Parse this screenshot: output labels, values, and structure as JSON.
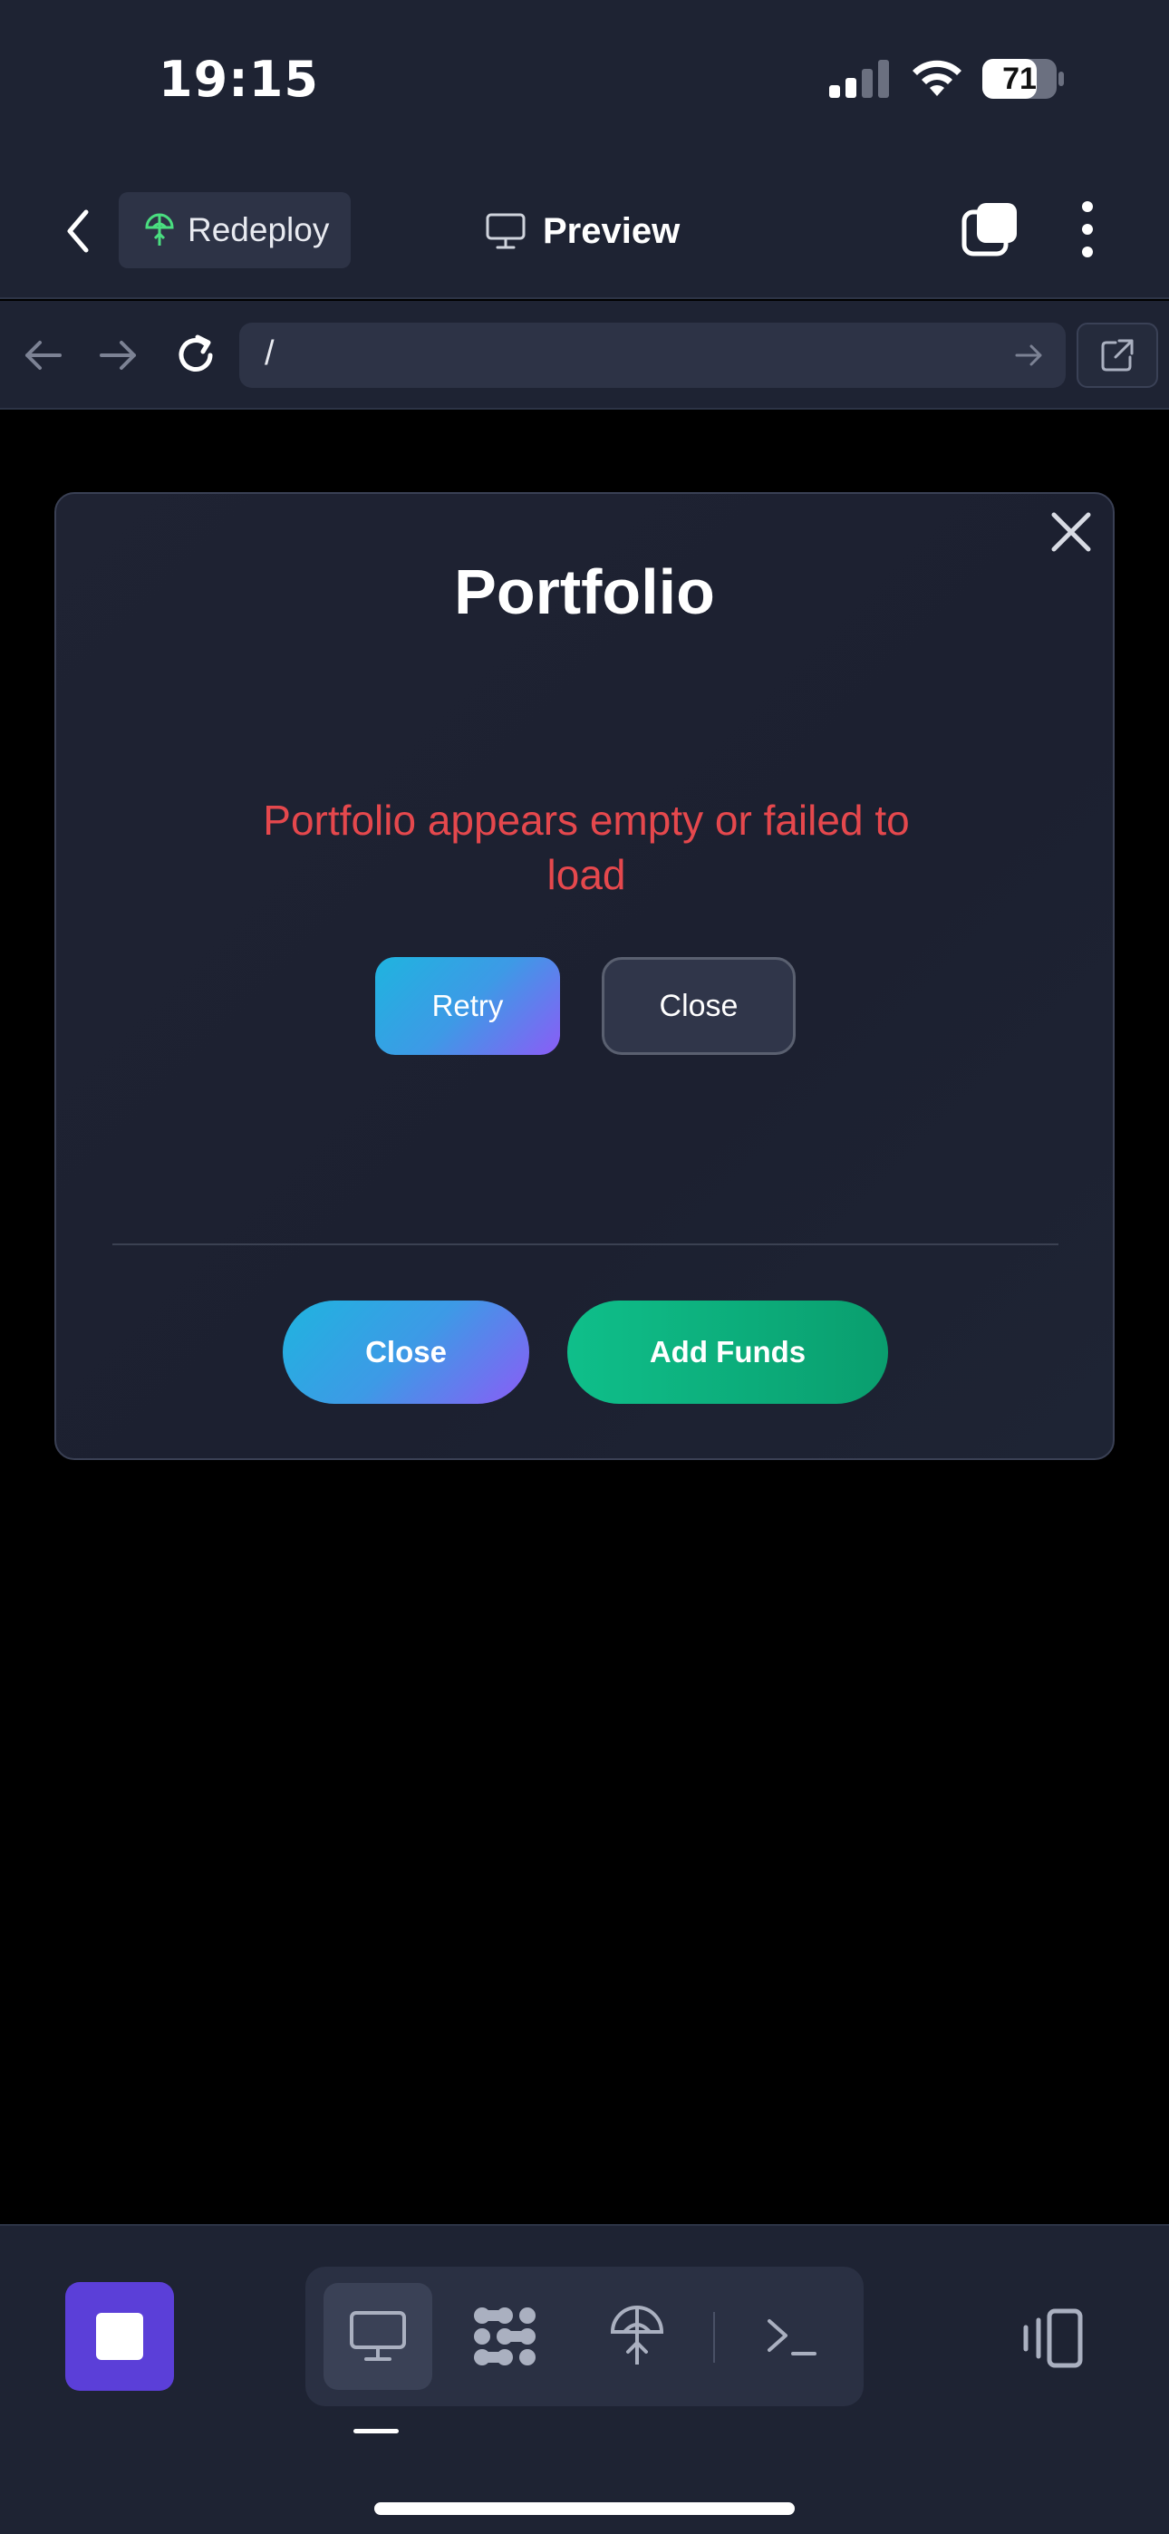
{
  "status_bar": {
    "time": "19:15",
    "battery_level": "71"
  },
  "topbar": {
    "redeploy_label": "Redeploy",
    "preview_label": "Preview"
  },
  "browser": {
    "url": "/"
  },
  "modal": {
    "title": "Portfolio",
    "error_message": "Portfolio appears empty or failed to load",
    "retry_label": "Retry",
    "close_secondary_label": "Close",
    "footer_close_label": "Close",
    "add_funds_label": "Add Funds"
  },
  "toolbar": {
    "tools": [
      "monitor-icon",
      "modules-icon",
      "deploy-icon",
      "terminal-icon"
    ],
    "active_tool": "monitor-icon"
  },
  "colors": {
    "background": "#1e2333",
    "error": "#e5484d",
    "primary_gradient_start": "#1fb4df",
    "primary_gradient_end": "#8b5cf6",
    "success": "#0fbf8a",
    "stop_button": "#5b3fd8"
  }
}
